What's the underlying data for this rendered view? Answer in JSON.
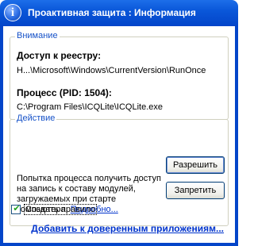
{
  "window": {
    "title": "Проактивная защита : Информация",
    "icon": "info-icon",
    "icon_glyph": "i"
  },
  "warning_group": {
    "legend": "Внимание",
    "registry_label": "Доступ к реестру:",
    "registry_value": "H...\\Microsoft\\Windows\\CurrentVersion\\RunOnce",
    "process_label": "Процесс (PID: 1504):",
    "process_value": "C:\\Program Files\\ICQLite\\ICQLite.exe"
  },
  "action_group": {
    "legend": "Действие",
    "allow_button": "Разрешить",
    "deny_button": "Запретить",
    "description": "Попытка процесса получить доступ на запись к составу модулей, загружаемых при старте компьютера.",
    "details_link": "Подробно..."
  },
  "create_rule": {
    "label": "Создать правило",
    "checked": true
  },
  "trusted_link": "Добавить к доверенным приложениям...",
  "colors": {
    "titlebar": "#0a57d9",
    "legend": "#1652c8",
    "link": "#0033cc"
  }
}
